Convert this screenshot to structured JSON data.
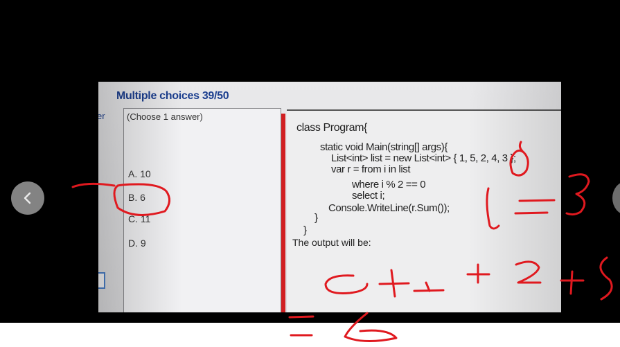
{
  "quiz": {
    "heading": "Multiple choices 39/50",
    "edge_fragment": "er",
    "instruction": "(Choose 1 answer)",
    "options": [
      "A. 10",
      "B. 6",
      "C. 11",
      "D. 9"
    ]
  },
  "question": {
    "code_lines": [
      "class Program{",
      "static void Main(string[] args){",
      "List<int> list = new List<int> { 1, 5, 2, 4, 3 };",
      "var r = from i in list",
      "where i % 2 == 0",
      "select i;",
      "Console.WriteLine(r.Sum());",
      "}",
      "}"
    ],
    "prompt": "The output will be:"
  },
  "colors": {
    "heading": "#1c3f8f",
    "divider": "#d11f22",
    "annotation": "#e0191f",
    "nav_button": "#8f8f8f"
  },
  "icons": {
    "prev": "chevron-left-icon"
  }
}
